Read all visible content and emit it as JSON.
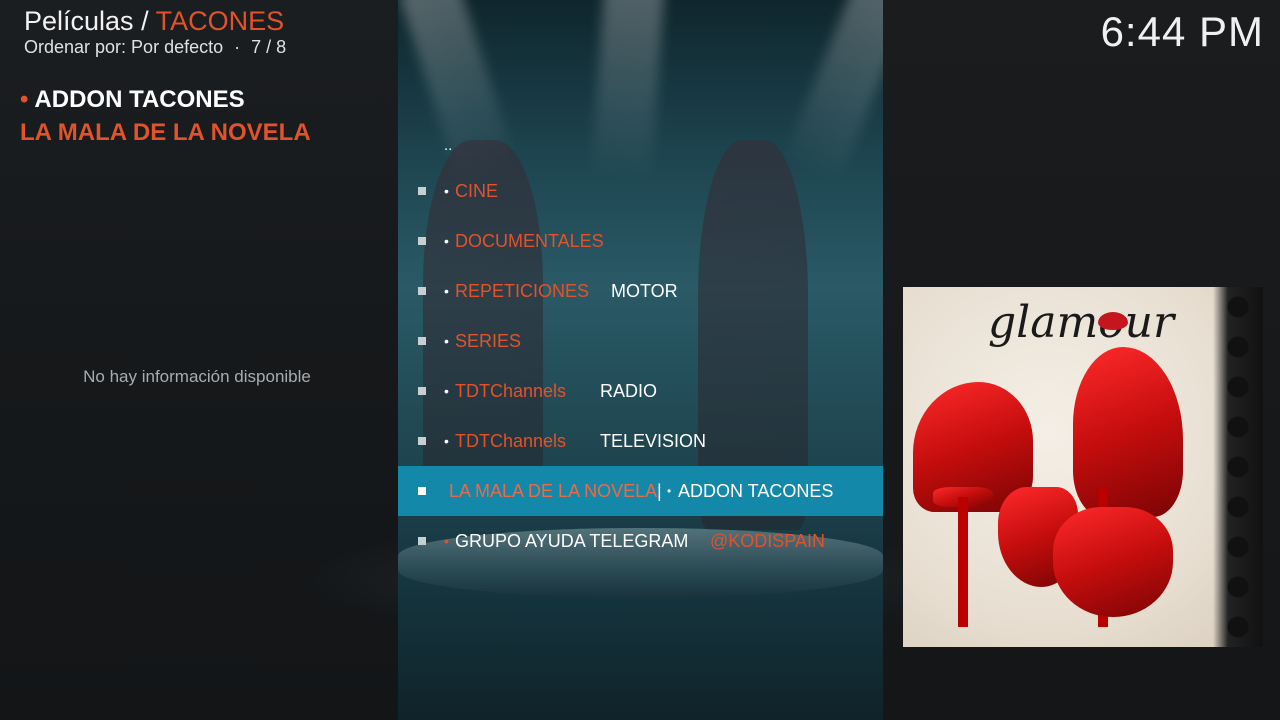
{
  "header": {
    "section": "Películas",
    "separator": "/",
    "folder": "TACONES",
    "sort_label": "Ordenar por: Por defecto",
    "dot": "·",
    "position": "7 / 8"
  },
  "clock": "6:44 PM",
  "info": {
    "bullet": "•",
    "line1": "ADDON TACONES",
    "line2": "LA MALA DE LA NOVELA",
    "no_info": "No hay información disponible"
  },
  "list": {
    "parent": "..",
    "items": [
      {
        "bullet": "•",
        "primary": "CINE",
        "secondary": ""
      },
      {
        "bullet": "•",
        "primary": "DOCUMENTALES",
        "secondary": ""
      },
      {
        "bullet": "•",
        "primary": "REPETICIONES",
        "secondary": "MOTOR"
      },
      {
        "bullet": "•",
        "primary": "SERIES",
        "secondary": ""
      },
      {
        "bullet": "•",
        "primary": "TDTChannels",
        "secondary": "RADIO"
      },
      {
        "bullet": "•",
        "primary": "TDTChannels",
        "secondary": "TELEVISION"
      },
      {
        "bullet": "",
        "primary": "LA MALA DE LA NOVELA",
        "pipe": "|",
        "bullet2": "•",
        "secondary": "ADDON TACONES"
      },
      {
        "bullet": "•",
        "primary": "GRUPO AYUDA TELEGRAM",
        "secondary": "@KODISPAIN"
      }
    ]
  },
  "poster": {
    "title": "glamour"
  },
  "colors": {
    "accent": "#e0532b",
    "selection": "#1388a9"
  }
}
